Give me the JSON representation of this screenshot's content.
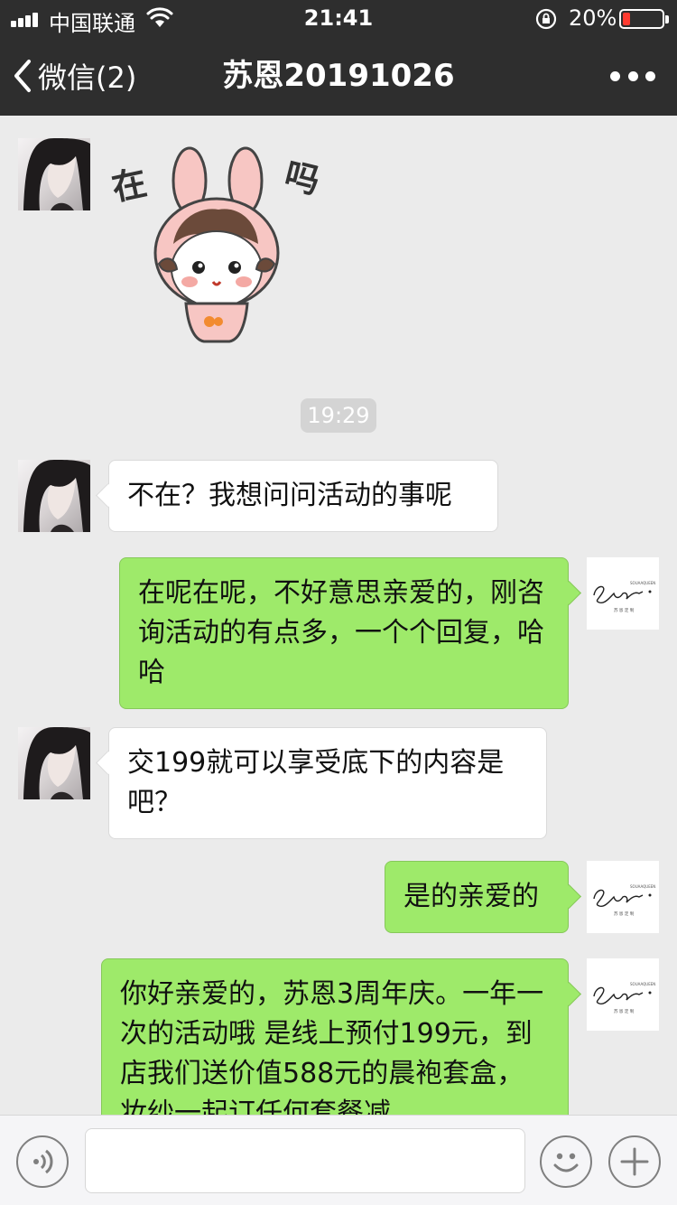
{
  "status_bar": {
    "carrier": "中国联通",
    "time": "21:41",
    "battery_percent": "20%",
    "battery_level": 0.2,
    "battery_color": "#ff3b30"
  },
  "nav": {
    "back_label": "微信(2)",
    "title": "苏恩20191026"
  },
  "chat": {
    "timestamp": "19:29",
    "sticker_text_left": "在",
    "sticker_text_right": "吗",
    "messages": [
      {
        "text": "不在？我想问问活动的事呢"
      },
      {
        "text": "在呢在呢，不好意思亲爱的，刚咨询活动的有点多，一个个回复，哈哈"
      },
      {
        "text": "交199就可以享受底下的内容是吧？"
      },
      {
        "text": "是的亲爱的"
      },
      {
        "text": "你好亲爱的，苏恩3周年庆。一年一次的活动哦 是线上预付199元，到店我们送价值588元的晨袍套盒，妆纱一起订任何套餐减"
      }
    ]
  },
  "brand_avatar": {
    "line1": "SOUAAQUEEN",
    "line2": "苏 恩 定 制"
  },
  "colors": {
    "header_bg": "#2e2e2e",
    "chat_bg": "#ebebeb",
    "sent_bubble": "#9eea6a",
    "received_bubble": "#ffffff"
  }
}
